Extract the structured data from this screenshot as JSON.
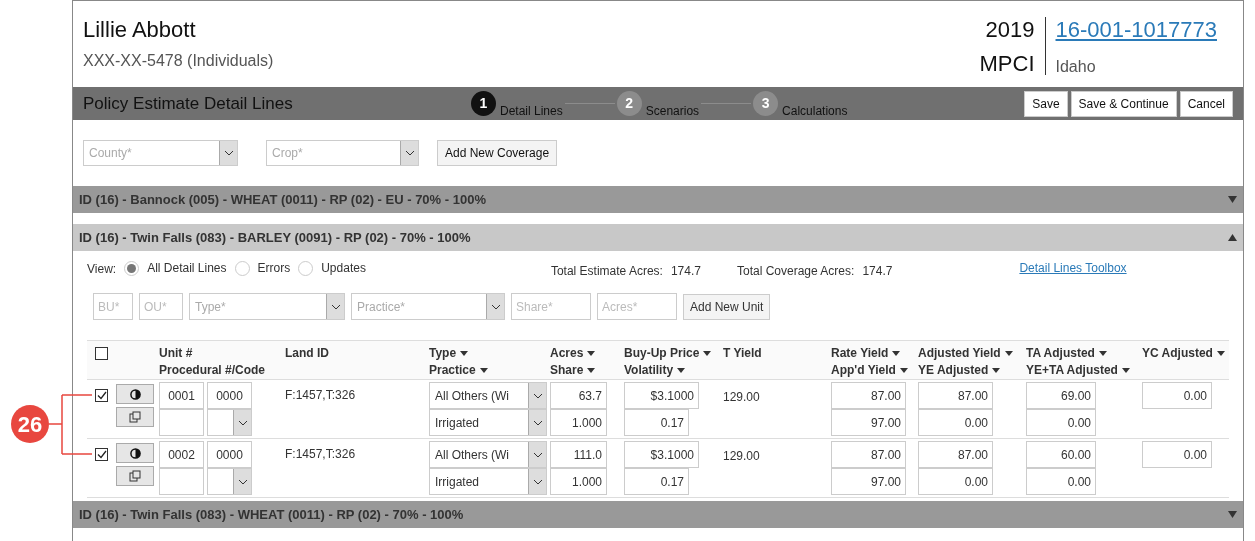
{
  "header": {
    "name": "Lillie Abbott",
    "ssn": "XXX-XX-5478 (Individuals)",
    "year": "2019",
    "program": "MPCI",
    "policy_number": "16-001-1017773",
    "state": "Idaho"
  },
  "toolbar": {
    "title": "Policy Estimate Detail Lines",
    "steps": [
      {
        "number": "1",
        "label": "Detail Lines",
        "selected": true
      },
      {
        "number": "2",
        "label": "Scenarios",
        "selected": false
      },
      {
        "number": "3",
        "label": "Calculations",
        "selected": false
      }
    ],
    "buttons": [
      "Save",
      "Save & Continue",
      "Cancel"
    ]
  },
  "coverage_filter": {
    "county_placeholder": "County*",
    "crop_placeholder": "Crop*",
    "button": "Add New Coverage"
  },
  "sections": [
    {
      "title": "ID (16) - Bannock (005) - WHEAT (0011) - RP (02) - EU - 70% - 100%",
      "expanded": false
    },
    {
      "title": "ID (16) - Twin Falls (083) - BARLEY (0091) - RP (02) - 70% - 100%",
      "expanded": true
    },
    {
      "title": "ID (16) - Twin Falls (083) - WHEAT (0011) - RP (02) - 70% - 100%",
      "expanded": false
    }
  ],
  "detail": {
    "view_label": "View:",
    "view_options": [
      {
        "label": "All Detail Lines",
        "selected": true
      },
      {
        "label": "Errors",
        "selected": false
      },
      {
        "label": "Updates",
        "selected": false
      }
    ],
    "totals": [
      {
        "label": "Total Estimate Acres:",
        "value": "174.7"
      },
      {
        "label": "Total Coverage Acres:",
        "value": "174.7"
      }
    ],
    "toolbox_link": "Detail Lines Toolbox",
    "unit_form": {
      "bu_placeholder": "BU*",
      "ou_placeholder": "OU*",
      "type_placeholder": "Type*",
      "practice_placeholder": "Practice*",
      "share_placeholder": "Share*",
      "acres_placeholder": "Acres*",
      "button": "Add New Unit"
    },
    "select_all_checked": false,
    "columns": [
      {
        "lines": [
          {
            "text": "Unit #",
            "sortable": false
          },
          {
            "text": "Procedural #/Code",
            "sortable": false
          }
        ]
      },
      {
        "lines": [
          {
            "text": "Land ID",
            "sortable": false
          }
        ]
      },
      {
        "lines": [
          {
            "text": "Type",
            "sortable": true
          },
          {
            "text": "Practice",
            "sortable": true
          }
        ]
      },
      {
        "lines": [
          {
            "text": "Acres",
            "sortable": true
          },
          {
            "text": "Share",
            "sortable": true
          }
        ]
      },
      {
        "lines": [
          {
            "text": "Buy-Up Price",
            "sortable": true
          },
          {
            "text": "Volatility",
            "sortable": true
          }
        ]
      },
      {
        "lines": [
          {
            "text": "T Yield",
            "sortable": false
          }
        ]
      },
      {
        "lines": [
          {
            "text": "Rate Yield",
            "sortable": true
          },
          {
            "text": "App'd Yield",
            "sortable": true
          }
        ]
      },
      {
        "lines": [
          {
            "text": "Adjusted Yield",
            "sortable": true
          },
          {
            "text": "YE Adjusted",
            "sortable": true
          }
        ]
      },
      {
        "lines": [
          {
            "text": "TA Adjusted",
            "sortable": true
          },
          {
            "text": "YE+TA Adjusted",
            "sortable": true
          }
        ]
      },
      {
        "lines": [
          {
            "text": "YC Adjusted",
            "sortable": true
          }
        ]
      }
    ],
    "rows": [
      {
        "checked": true,
        "unit": "0001",
        "code": "0000",
        "land_id": "F:1457,T:326",
        "type": "All Others (Wi",
        "practice": "Irrigated",
        "acres": "63.7",
        "share": "1.000",
        "buy_up_price": "$3.1000",
        "volatility": "0.17",
        "t_yield": "129.00",
        "rate_yield": "87.00",
        "appd_yield": "97.00",
        "adjusted_yield": "87.00",
        "ye_adjusted": "0.00",
        "ta_adjusted": "69.00",
        "ye_ta_adjusted": "0.00",
        "yc_adjusted": "0.00"
      },
      {
        "checked": true,
        "unit": "0002",
        "code": "0000",
        "land_id": "F:1457,T:326",
        "type": "All Others (Wi",
        "practice": "Irrigated",
        "acres": "111.0",
        "share": "1.000",
        "buy_up_price": "$3.1000",
        "volatility": "0.17",
        "t_yield": "129.00",
        "rate_yield": "87.00",
        "appd_yield": "97.00",
        "adjusted_yield": "87.00",
        "ye_adjusted": "0.00",
        "ta_adjusted": "60.00",
        "ye_ta_adjusted": "0.00",
        "yc_adjusted": "0.00"
      }
    ]
  },
  "callout": {
    "label": "26"
  }
}
